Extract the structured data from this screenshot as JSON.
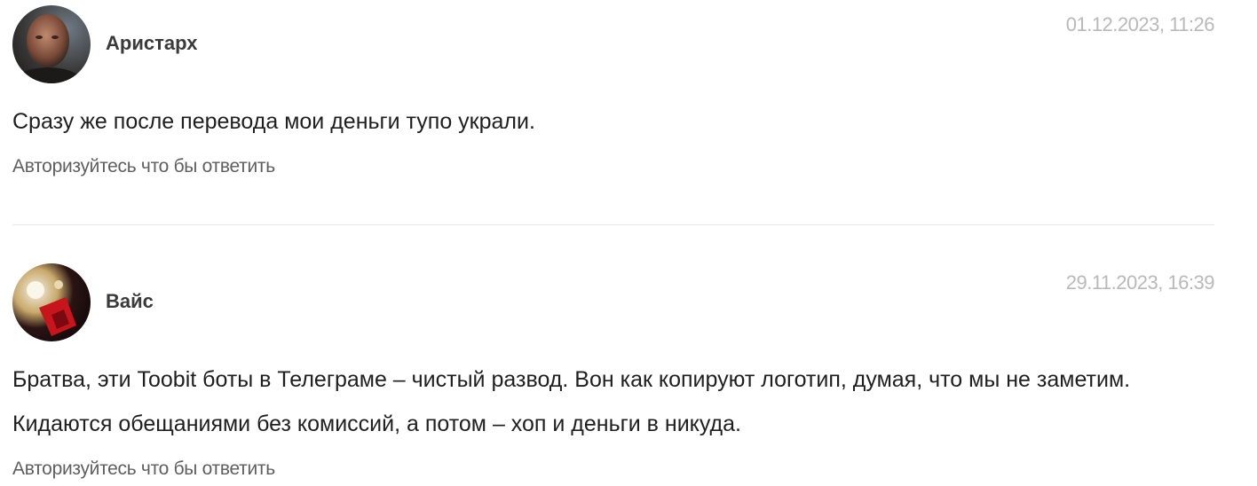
{
  "comments": [
    {
      "author": "Аристарх",
      "date": "01.12.2023, 11:26",
      "text": "Сразу же после перевода мои деньги тупо украли.",
      "reply_label": "Авторизуйтесь что бы ответить",
      "avatar_icon": "user-photo-avatar"
    },
    {
      "author": "Вайс",
      "date": "29.11.2023, 16:39",
      "text": "Братва, эти Toobit боты в Телеграме – чистый развод. Вон как копируют логотип, думая, что мы не заметим. Кидаются обещаниями без комиссий, а потом – хоп и деньги в никуда.",
      "reply_label": "Авторизуйтесь что бы ответить",
      "avatar_icon": "user-photo-avatar"
    }
  ]
}
